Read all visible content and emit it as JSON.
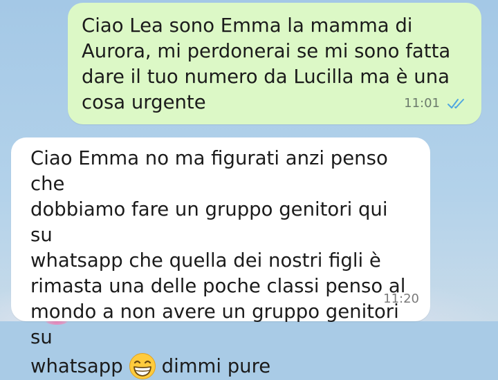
{
  "messages": {
    "outgoing": {
      "text": "Ciao Lea sono Emma la mamma di\nAurora, mi perdonerai se mi sono fatta\ndare il tuo numero da Lucilla ma è una\ncosa urgente",
      "time": "11:01",
      "status_icon": "double-check-read-icon",
      "bubble_color": "#dcf8c6"
    },
    "incoming": {
      "text_main": "Ciao Emma no ma figurati anzi penso che\ndobbiamo fare un gruppo genitori qui su\nwhatsapp che quella dei nostri figli è\nrimasta una delle poche classi penso al\nmondo a non avere un gruppo genitori su",
      "text_before_emoji": "whatsapp",
      "emoji": "grinning-face-with-smiling-eyes-emoji",
      "text_after_emoji": "dimmi pure",
      "time": "11:20",
      "bubble_color": "#ffffff"
    }
  },
  "colors": {
    "read_tick": "#4fa6e0",
    "chat_background": "#a9cbe6"
  }
}
